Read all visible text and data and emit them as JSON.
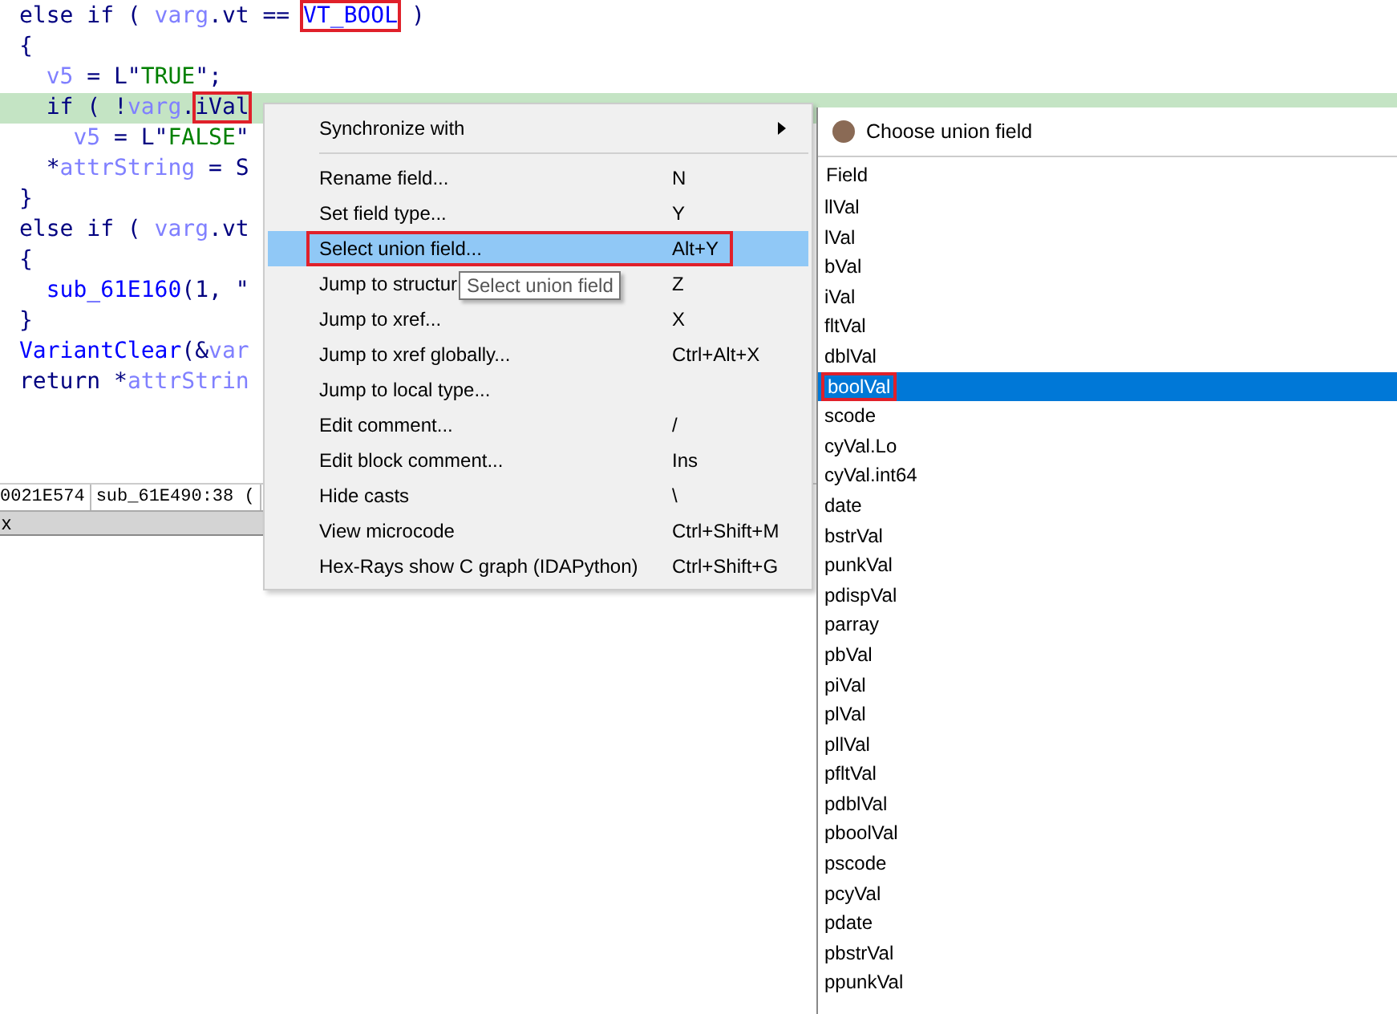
{
  "code_lines": [
    {
      "highlighted": false,
      "tokens": [
        {
          "text": "else if ( ",
          "kind": "kw"
        },
        {
          "text": "varg",
          "kind": "var"
        },
        {
          "text": ".vt == ",
          "kind": "kw"
        },
        {
          "text": "VT_BOOL",
          "kind": "const",
          "marked": true
        },
        {
          "text": " )",
          "kind": "kw"
        }
      ]
    },
    {
      "highlighted": false,
      "tokens": [
        {
          "text": "{",
          "kind": "kw"
        }
      ]
    },
    {
      "highlighted": false,
      "tokens": [
        {
          "text": "  v5",
          "kind": "var"
        },
        {
          "text": " = L\"",
          "kind": "kw"
        },
        {
          "text": "TRUE",
          "kind": "str"
        },
        {
          "text": "\";",
          "kind": "kw"
        }
      ]
    },
    {
      "highlighted": true,
      "tokens": [
        {
          "text": "  if ( !",
          "kind": "kw"
        },
        {
          "text": "varg",
          "kind": "var"
        },
        {
          "text": ".",
          "kind": "kw"
        },
        {
          "text": "iVal",
          "kind": "kw",
          "marked": true
        }
      ]
    },
    {
      "highlighted": false,
      "tokens": [
        {
          "text": "    v5",
          "kind": "var"
        },
        {
          "text": " = L\"",
          "kind": "kw"
        },
        {
          "text": "FALSE",
          "kind": "str"
        },
        {
          "text": "\"",
          "kind": "kw"
        }
      ]
    },
    {
      "highlighted": false,
      "tokens": [
        {
          "text": "  *",
          "kind": "kw"
        },
        {
          "text": "attrString",
          "kind": "var"
        },
        {
          "text": " = S",
          "kind": "kw"
        }
      ]
    },
    {
      "highlighted": false,
      "tokens": [
        {
          "text": "}",
          "kind": "kw"
        }
      ]
    },
    {
      "highlighted": false,
      "tokens": [
        {
          "text": "else if ( ",
          "kind": "kw"
        },
        {
          "text": "varg",
          "kind": "var"
        },
        {
          "text": ".vt",
          "kind": "kw"
        }
      ]
    },
    {
      "highlighted": false,
      "tokens": [
        {
          "text": "{",
          "kind": "kw"
        }
      ]
    },
    {
      "highlighted": false,
      "tokens": [
        {
          "text": "  sub_61E160",
          "kind": "func"
        },
        {
          "text": "(1, \"",
          "kind": "kw"
        }
      ]
    },
    {
      "highlighted": false,
      "tokens": [
        {
          "text": "}",
          "kind": "kw"
        }
      ]
    },
    {
      "highlighted": false,
      "tokens": [
        {
          "text": "VariantClear",
          "kind": "func"
        },
        {
          "text": "(&",
          "kind": "kw"
        },
        {
          "text": "var",
          "kind": "var"
        }
      ]
    },
    {
      "highlighted": false,
      "tokens": [
        {
          "text": "return *",
          "kind": "kw"
        },
        {
          "text": "attrStrin",
          "kind": "var"
        }
      ]
    }
  ],
  "status_bar": {
    "address": "0021E574",
    "location": "sub_61E490:38 ("
  },
  "bottom_tab": {
    "label": "x"
  },
  "context_menu": {
    "items": [
      {
        "kind": "submenu",
        "label": "Synchronize with",
        "selected": false
      },
      {
        "kind": "separator"
      },
      {
        "kind": "item",
        "label": "Rename field...",
        "shortcut": "N",
        "selected": false
      },
      {
        "kind": "item",
        "label": "Set field type...",
        "shortcut": "Y",
        "selected": false
      },
      {
        "kind": "item",
        "label": "Select union field...",
        "shortcut": "Alt+Y",
        "selected": true
      },
      {
        "kind": "item",
        "label": "Jump to structur",
        "shortcut": "Z",
        "selected": false
      },
      {
        "kind": "item",
        "label": "Jump to xref...",
        "shortcut": "X",
        "selected": false
      },
      {
        "kind": "item",
        "label": "Jump to xref globally...",
        "shortcut": "Ctrl+Alt+X",
        "selected": false
      },
      {
        "kind": "item",
        "label": "Jump to local type...",
        "selected": false
      },
      {
        "kind": "item",
        "label": "Edit comment...",
        "shortcut": "/",
        "selected": false
      },
      {
        "kind": "item",
        "label": "Edit block comment...",
        "shortcut": "Ins",
        "selected": false
      },
      {
        "kind": "item",
        "label": "Hide casts",
        "shortcut": "\\",
        "selected": false
      },
      {
        "kind": "item",
        "label": "View microcode",
        "shortcut": "Ctrl+Shift+M",
        "selected": false
      },
      {
        "kind": "item",
        "label": "Hex-Rays show C graph (IDAPython)",
        "shortcut": "Ctrl+Shift+G",
        "selected": false
      }
    ]
  },
  "tooltip": {
    "text": "Select union field"
  },
  "dialog": {
    "title": "Choose union field",
    "column": "Field",
    "rows": [
      {
        "label": "llVal",
        "selected": false
      },
      {
        "label": "lVal",
        "selected": false
      },
      {
        "label": "bVal",
        "selected": false
      },
      {
        "label": "iVal",
        "selected": false
      },
      {
        "label": "fltVal",
        "selected": false
      },
      {
        "label": "dblVal",
        "selected": false
      },
      {
        "label": "boolVal",
        "selected": true
      },
      {
        "label": "scode",
        "selected": false
      },
      {
        "label": "cyVal.Lo",
        "selected": false
      },
      {
        "label": "cyVal.int64",
        "selected": false
      },
      {
        "label": "date",
        "selected": false
      },
      {
        "label": "bstrVal",
        "selected": false
      },
      {
        "label": "punkVal",
        "selected": false
      },
      {
        "label": "pdispVal",
        "selected": false
      },
      {
        "label": "parray",
        "selected": false
      },
      {
        "label": "pbVal",
        "selected": false
      },
      {
        "label": "piVal",
        "selected": false
      },
      {
        "label": "plVal",
        "selected": false
      },
      {
        "label": "pllVal",
        "selected": false
      },
      {
        "label": "pfltVal",
        "selected": false
      },
      {
        "label": "pdblVal",
        "selected": false
      },
      {
        "label": "pboolVal",
        "selected": false
      },
      {
        "label": "pscode",
        "selected": false
      },
      {
        "label": "pcyVal",
        "selected": false
      },
      {
        "label": "pdate",
        "selected": false
      },
      {
        "label": "pbstrVal",
        "selected": false
      },
      {
        "label": "ppunkVal",
        "selected": false
      }
    ]
  }
}
